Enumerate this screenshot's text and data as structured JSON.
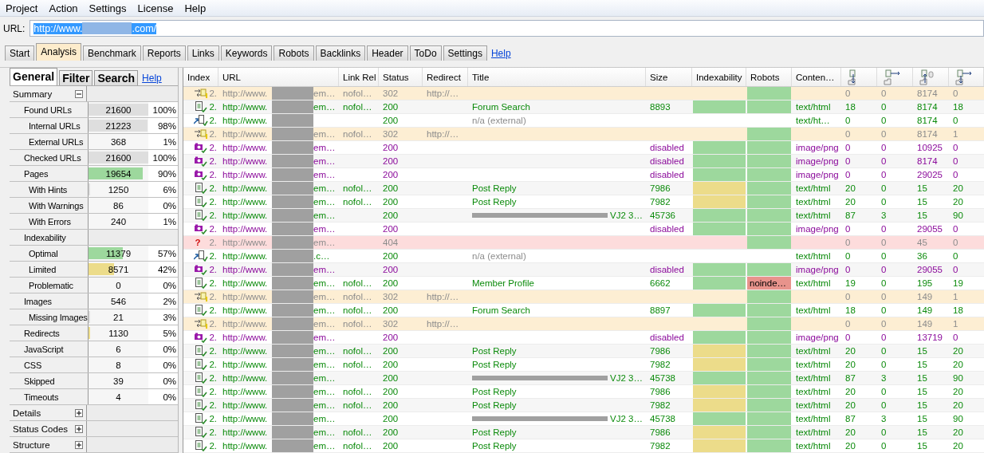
{
  "menu": [
    "Project",
    "Action",
    "Settings",
    "License",
    "Help"
  ],
  "url": {
    "label": "URL:",
    "prefix": "http://www.",
    "suffix": ".com/",
    "selected": true
  },
  "tabs": [
    {
      "label": "Start",
      "selected": false
    },
    {
      "label": "Analysis",
      "selected": true
    },
    {
      "label": "Benchmark",
      "selected": false
    },
    {
      "label": "Reports",
      "selected": false
    },
    {
      "label": "Links",
      "selected": false
    },
    {
      "label": "Keywords",
      "selected": false
    },
    {
      "label": "Robots",
      "selected": false
    },
    {
      "label": "Backlinks",
      "selected": false
    },
    {
      "label": "Header",
      "selected": false
    },
    {
      "label": "ToDo",
      "selected": false
    },
    {
      "label": "Settings",
      "selected": false
    }
  ],
  "tabs_help": "Help",
  "side_tabs": [
    {
      "label": "General",
      "selected": true
    },
    {
      "label": "Filter",
      "selected": false
    },
    {
      "label": "Search",
      "selected": false
    }
  ],
  "side_help": "Help",
  "groups": [
    {
      "label": "Summary",
      "expanded": true,
      "children": [
        {
          "label": "Found URLs",
          "value": "21600",
          "pct": "100%",
          "level": 1,
          "color": "#dedede",
          "children": [
            {
              "label": "Internal URLs",
              "value": "21223",
              "pct": "98%",
              "level": 0.98,
              "color": "#dedede"
            },
            {
              "label": "External URLs",
              "value": "368",
              "pct": "1%"
            }
          ]
        },
        {
          "label": "Checked URLs",
          "value": "21600",
          "pct": "100%",
          "level": 1,
          "color": "#dedede"
        },
        {
          "label": "Pages",
          "value": "19654",
          "pct": "90%",
          "level": 0.9,
          "color": "#9dd89d",
          "children": [
            {
              "label": "With Hints",
              "value": "1250",
              "pct": "6%",
              "level": 0.03,
              "color": "#dedede"
            },
            {
              "label": "With Warnings",
              "value": "86",
              "pct": "0%"
            },
            {
              "label": "With Errors",
              "value": "240",
              "pct": "1%"
            }
          ]
        },
        {
          "label": "Indexability",
          "children": [
            {
              "label": "Optimal",
              "value": "11379",
              "pct": "57%",
              "level": 0.57,
              "color": "#9dd89d"
            },
            {
              "label": "Limited",
              "value": "8571",
              "pct": "42%",
              "level": 0.42,
              "color": "#ecdc8a"
            },
            {
              "label": "Problematic",
              "value": "0",
              "pct": "0%"
            }
          ]
        },
        {
          "label": "Images",
          "value": "546",
          "pct": "2%",
          "children": [
            {
              "label": "Missing Images",
              "value": "21",
              "pct": "3%",
              "level": 0.02,
              "color": "#dedede"
            }
          ]
        },
        {
          "label": "Redirects",
          "value": "1130",
          "pct": "5%",
          "level": 0.02,
          "color": "#ecdc8a"
        },
        {
          "label": "JavaScript",
          "value": "6",
          "pct": "0%"
        },
        {
          "label": "CSS",
          "value": "8",
          "pct": "0%"
        },
        {
          "label": "Skipped",
          "value": "39",
          "pct": "0%"
        },
        {
          "label": "Timeouts",
          "value": "4",
          "pct": "0%"
        }
      ]
    },
    {
      "label": "Details",
      "expanded": false
    },
    {
      "label": "Status Codes",
      "expanded": false
    },
    {
      "label": "Structure",
      "expanded": false
    }
  ],
  "table": {
    "columns": [
      "Index",
      "URL",
      "Link Rel",
      "Status",
      "Redirect",
      "Title",
      "Size",
      "Indexability",
      "Robots",
      "Conten…"
    ],
    "count_columns": [
      {
        "kind": "down"
      },
      {
        "kind": "right"
      },
      {
        "kind": "up"
      },
      {
        "kind": "both"
      }
    ],
    "rows": [
      {
        "kind": "redirect",
        "index": "2.",
        "url_start": "http://www.",
        "url_end": "em…",
        "link_rel": "nofol…",
        "status": "302",
        "redirect": "http://…",
        "robots": {
          "color": "#9dd89d"
        },
        "counts": [
          "0",
          "0",
          "8174",
          "0"
        ]
      },
      {
        "kind": "page",
        "index": "2.",
        "url_start": "http://www.",
        "url_end": "em…",
        "link_rel": "nofol…",
        "status": "200",
        "title": "Forum Search",
        "size": "8893",
        "indexability": {
          "color": "#9dd89d"
        },
        "robots": {
          "color": "#9dd89d"
        },
        "content": "text/html",
        "counts": [
          "18",
          "0",
          "8174",
          "18"
        ]
      },
      {
        "kind": "external",
        "index": "2.",
        "url_start": "http://www.",
        "status": "200",
        "title": "n/a (external)",
        "content": "text/ht…",
        "counts": [
          "0",
          "0",
          "8174",
          "0"
        ]
      },
      {
        "kind": "redirect",
        "index": "2.",
        "url_start": "http://www.",
        "url_end": "em…",
        "link_rel": "nofol…",
        "status": "302",
        "redirect": "http://…",
        "robots": {
          "color": "#9dd89d"
        },
        "counts": [
          "0",
          "0",
          "8174",
          "1"
        ]
      },
      {
        "kind": "image",
        "index": "2.",
        "url_start": "http://www.",
        "url_end": "em…",
        "status": "200",
        "size": "disabled",
        "indexability": {
          "color": "#9dd89d"
        },
        "robots": {
          "color": "#9dd89d"
        },
        "content": "image/png",
        "counts": [
          "0",
          "0",
          "10925",
          "0"
        ]
      },
      {
        "kind": "image",
        "index": "2.",
        "url_start": "http://www.",
        "url_end": "em…",
        "status": "200",
        "size": "disabled",
        "indexability": {
          "color": "#9dd89d"
        },
        "robots": {
          "color": "#9dd89d"
        },
        "content": "image/png",
        "counts": [
          "0",
          "0",
          "8174",
          "0"
        ]
      },
      {
        "kind": "image",
        "index": "2.",
        "url_start": "http://www.",
        "url_end": "em…",
        "status": "200",
        "size": "disabled",
        "indexability": {
          "color": "#9dd89d"
        },
        "robots": {
          "color": "#9dd89d"
        },
        "content": "image/png",
        "counts": [
          "0",
          "0",
          "29025",
          "0"
        ]
      },
      {
        "kind": "page",
        "index": "2.",
        "url_start": "http://www.",
        "url_end": "em…",
        "link_rel": "nofol…",
        "status": "200",
        "title": "Post Reply",
        "size": "7986",
        "indexability": {
          "color": "#ecdc8a"
        },
        "robots": {
          "color": "#9dd89d"
        },
        "content": "text/html",
        "counts": [
          "20",
          "0",
          "15",
          "20"
        ]
      },
      {
        "kind": "page",
        "index": "2.",
        "url_start": "http://www.",
        "url_end": "em…",
        "link_rel": "nofol…",
        "status": "200",
        "title": "Post Reply",
        "size": "7982",
        "indexability": {
          "color": "#ecdc8a"
        },
        "robots": {
          "color": "#9dd89d"
        },
        "content": "text/html",
        "counts": [
          "20",
          "0",
          "15",
          "20"
        ]
      },
      {
        "kind": "page",
        "index": "2.",
        "url_start": "http://www.",
        "url_end": "em…",
        "status": "200",
        "title": "VJ2 3…",
        "title_redacted": true,
        "size": "45736",
        "indexability": {
          "color": "#9dd89d"
        },
        "robots": {
          "color": "#9dd89d"
        },
        "content": "text/html",
        "counts": [
          "87",
          "3",
          "15",
          "90"
        ]
      },
      {
        "kind": "image",
        "index": "2.",
        "url_start": "http://www.",
        "url_end": "em…",
        "status": "200",
        "size": "disabled",
        "indexability": {
          "color": "#9dd89d"
        },
        "robots": {
          "color": "#9dd89d"
        },
        "content": "image/png",
        "counts": [
          "0",
          "0",
          "29055",
          "0"
        ]
      },
      {
        "kind": "error",
        "mark": "?",
        "index": "2.",
        "url_start": "http://www.",
        "url_end": "em…",
        "status": "404",
        "robots": {
          "color": "#9dd89d"
        },
        "counts": [
          "0",
          "0",
          "45",
          "0"
        ]
      },
      {
        "kind": "external",
        "index": "2.",
        "url_start": "http://www.",
        "url_end": ".c…",
        "status": "200",
        "title": "n/a (external)",
        "content": "text/html",
        "counts": [
          "0",
          "0",
          "36",
          "0"
        ]
      },
      {
        "kind": "image",
        "index": "2.",
        "url_start": "http://www.",
        "url_end": "em…",
        "status": "200",
        "size": "disabled",
        "indexability": {
          "color": "#9dd89d"
        },
        "robots": {
          "color": "#9dd89d"
        },
        "content": "image/png",
        "counts": [
          "0",
          "0",
          "29055",
          "0"
        ]
      },
      {
        "kind": "page",
        "index": "2.",
        "url_start": "http://www.",
        "url_end": "em…",
        "link_rel": "nofol…",
        "status": "200",
        "title": "Member Profile",
        "size": "6662",
        "indexability": {
          "color": "#9dd89d"
        },
        "robots": {
          "color": "#e8938c",
          "text": "noinde…"
        },
        "content": "text/html",
        "counts": [
          "19",
          "0",
          "195",
          "19"
        ]
      },
      {
        "kind": "redirect",
        "index": "2.",
        "url_start": "http://www.",
        "url_end": "em…",
        "link_rel": "nofol…",
        "status": "302",
        "redirect": "http://…",
        "robots": {
          "color": "#9dd89d"
        },
        "counts": [
          "0",
          "0",
          "149",
          "1"
        ]
      },
      {
        "kind": "page",
        "index": "2.",
        "url_start": "http://www.",
        "url_end": "em…",
        "link_rel": "nofol…",
        "status": "200",
        "title": "Forum Search",
        "size": "8897",
        "indexability": {
          "color": "#9dd89d"
        },
        "robots": {
          "color": "#9dd89d"
        },
        "content": "text/html",
        "counts": [
          "18",
          "0",
          "149",
          "18"
        ]
      },
      {
        "kind": "redirect",
        "index": "2.",
        "url_start": "http://www.",
        "url_end": "em…",
        "link_rel": "nofol…",
        "status": "302",
        "redirect": "http://…",
        "robots": {
          "color": "#9dd89d"
        },
        "counts": [
          "0",
          "0",
          "149",
          "1"
        ]
      },
      {
        "kind": "image",
        "index": "2.",
        "url_start": "http://www.",
        "url_end": "em…",
        "status": "200",
        "size": "disabled",
        "indexability": {
          "color": "#9dd89d"
        },
        "robots": {
          "color": "#9dd89d"
        },
        "content": "image/png",
        "counts": [
          "0",
          "0",
          "13719",
          "0"
        ]
      },
      {
        "kind": "page",
        "index": "2.",
        "url_start": "http://www.",
        "url_end": "em…",
        "link_rel": "nofol…",
        "status": "200",
        "title": "Post Reply",
        "size": "7986",
        "indexability": {
          "color": "#ecdc8a"
        },
        "robots": {
          "color": "#9dd89d"
        },
        "content": "text/html",
        "counts": [
          "20",
          "0",
          "15",
          "20"
        ]
      },
      {
        "kind": "page",
        "index": "2.",
        "url_start": "http://www.",
        "url_end": "em…",
        "link_rel": "nofol…",
        "status": "200",
        "title": "Post Reply",
        "size": "7982",
        "indexability": {
          "color": "#ecdc8a"
        },
        "robots": {
          "color": "#9dd89d"
        },
        "content": "text/html",
        "counts": [
          "20",
          "0",
          "15",
          "20"
        ]
      },
      {
        "kind": "page",
        "index": "2.",
        "url_start": "http://www.",
        "url_end": "em…",
        "status": "200",
        "title": "VJ2 3…",
        "title_redacted": true,
        "size": "45738",
        "indexability": {
          "color": "#9dd89d"
        },
        "robots": {
          "color": "#9dd89d"
        },
        "content": "text/html",
        "counts": [
          "87",
          "3",
          "15",
          "90"
        ]
      },
      {
        "kind": "page",
        "index": "2.",
        "url_start": "http://www.",
        "url_end": "em…",
        "link_rel": "nofol…",
        "status": "200",
        "title": "Post Reply",
        "size": "7986",
        "indexability": {
          "color": "#ecdc8a"
        },
        "robots": {
          "color": "#9dd89d"
        },
        "content": "text/html",
        "counts": [
          "20",
          "0",
          "15",
          "20"
        ]
      },
      {
        "kind": "page",
        "index": "2.",
        "url_start": "http://www.",
        "url_end": "em…",
        "link_rel": "nofol…",
        "status": "200",
        "title": "Post Reply",
        "size": "7982",
        "indexability": {
          "color": "#ecdc8a"
        },
        "robots": {
          "color": "#9dd89d"
        },
        "content": "text/html",
        "counts": [
          "20",
          "0",
          "15",
          "20"
        ]
      },
      {
        "kind": "page",
        "index": "2.",
        "url_start": "http://www.",
        "url_end": "em…",
        "status": "200",
        "title": "VJ2 3…",
        "title_redacted": true,
        "size": "45738",
        "indexability": {
          "color": "#9dd89d"
        },
        "robots": {
          "color": "#9dd89d"
        },
        "content": "text/html",
        "counts": [
          "87",
          "3",
          "15",
          "90"
        ]
      },
      {
        "kind": "page",
        "index": "2.",
        "url_start": "http://www.",
        "url_end": "em…",
        "link_rel": "nofol…",
        "status": "200",
        "title": "Post Reply",
        "size": "7986",
        "indexability": {
          "color": "#ecdc8a"
        },
        "robots": {
          "color": "#9dd89d"
        },
        "content": "text/html",
        "counts": [
          "20",
          "0",
          "15",
          "20"
        ]
      },
      {
        "kind": "page",
        "index": "2.",
        "url_start": "http://www.",
        "url_end": "em…",
        "link_rel": "nofol…",
        "status": "200",
        "title": "Post Reply",
        "size": "7982",
        "indexability": {
          "color": "#ecdc8a"
        },
        "robots": {
          "color": "#9dd89d"
        },
        "content": "text/html",
        "counts": [
          "20",
          "0",
          "15",
          "20"
        ]
      }
    ]
  }
}
